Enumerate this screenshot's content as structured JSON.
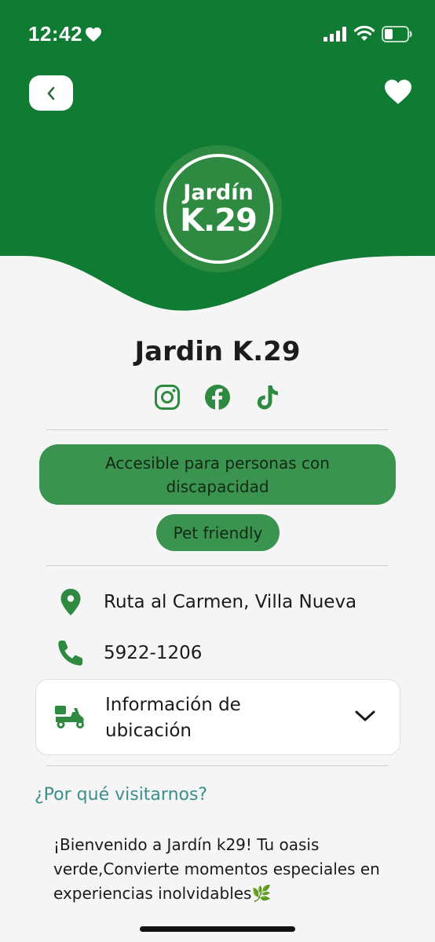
{
  "status_bar": {
    "time": "12:42"
  },
  "header": {
    "background_color": "#0f7b33"
  },
  "nav": {
    "back_icon": "chevron-left-icon",
    "favorite_icon": "heart-icon"
  },
  "logo": {
    "line1": "Jardín",
    "line2": "K.29"
  },
  "place": {
    "name": "Jardin K.29"
  },
  "socials": [
    "instagram-icon",
    "facebook-icon",
    "tiktok-icon"
  ],
  "tags": {
    "accessible": "Accesible para personas con discapacidad",
    "pet": "Pet friendly"
  },
  "contact": {
    "address": "Ruta al Carmen, Villa Nueva",
    "phone": "5922-1206"
  },
  "location_info": {
    "label": "Información de ubicación"
  },
  "about": {
    "heading": "¿Por qué visitarnos?",
    "text": "¡Bienvenido a Jardín k29! Tu oasis verde,Convierte momentos especiales en experiencias inolvidables🌿"
  },
  "colors": {
    "primary": "#0f7b33",
    "chip": "#3a9450",
    "accent_teal": "#3a8f8b"
  }
}
